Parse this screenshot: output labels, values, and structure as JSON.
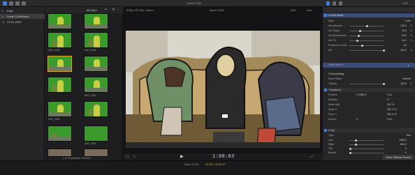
{
  "toolbar": {
    "tools_label": "Tools",
    "center_title": "Mark 3 Edit",
    "right_label": "4:56"
  },
  "sidebar": {
    "library": "Edyn",
    "items": [
      {
        "label": "Smart Collections",
        "selected": true
      },
      {
        "label": "21-01-2020",
        "selected": false
      }
    ]
  },
  "browser": {
    "filter": "All Clips",
    "thumbnails": [
      {
        "label": ""
      },
      {
        "label": ""
      },
      {
        "label": "IMG_0448"
      },
      {
        "label": "IMG_0449"
      },
      {
        "label": "IMG_0453"
      },
      {
        "label": ""
      },
      {
        "label": ""
      },
      {
        "label": "IMG_0450"
      },
      {
        "label": "IMG_0455"
      },
      {
        "label": ""
      },
      {
        "label": ""
      },
      {
        "label": "IMG_0461"
      },
      {
        "label": ""
      },
      {
        "label": ""
      }
    ],
    "status": "1 of 73 selected, 00:08:12"
  },
  "viewer": {
    "format": "1080p HD 30p, Stereo",
    "project": "Mark 3 Edit",
    "zoom": "80%",
    "view_label": "View",
    "timecode": "1:08:03"
  },
  "inspector": {
    "effect_name": "Comic Basic",
    "effect_params": [
      {
        "label": "Style",
        "value": "Color",
        "fraction": null
      },
      {
        "label": "Smoothness",
        "value": "100.0",
        "unit": "%",
        "fraction": 0.5
      },
      {
        "label": "Ink Edges",
        "value": "20.0",
        "unit": "%",
        "fraction": 0.3
      },
      {
        "label": "Ink Smoothness",
        "value": "15.0",
        "unit": "%",
        "fraction": 0.25
      },
      {
        "label": "Ink Fill",
        "value": "10.0",
        "unit": "%",
        "fraction": 0.2
      },
      {
        "label": "Posterize Levels",
        "value": "4.0",
        "unit": "",
        "fraction": 0.35
      },
      {
        "label": "Mix",
        "value": "100.0",
        "unit": "%",
        "fraction": 1.0
      }
    ],
    "color_board": "Color Board 1",
    "compositing": {
      "title": "Compositing",
      "blend_mode_label": "Blend Mode",
      "blend_mode": "Normal",
      "opacity_label": "Opacity",
      "opacity": "100.0",
      "opacity_fraction": 1.0
    },
    "transform": {
      "title": "Transform",
      "params": [
        {
          "label": "Position",
          "x": "X  1089.0",
          "y": "0  px"
        },
        {
          "label": "Rotation",
          "x": "",
          "y": "0  °"
        },
        {
          "label": "Scale (All)",
          "x": "",
          "y": "261  %"
        },
        {
          "label": "Scale X",
          "x": "",
          "y": "261.0  %"
        },
        {
          "label": "Scale Y",
          "x": "",
          "y": "261.0  %"
        },
        {
          "label": "Anchor",
          "x": "0",
          "y": "0  px"
        }
      ]
    },
    "crop": {
      "title": "Crop",
      "type_label": "Type",
      "type_value": "Trim",
      "params": [
        {
          "label": "Left",
          "value": "1080.0"
        },
        {
          "label": "Right",
          "value": "804.0"
        },
        {
          "label": "Top",
          "value": "0"
        },
        {
          "label": "Bottom",
          "value": "0"
        }
      ]
    },
    "save_button": "Save Effects Preset"
  },
  "statusbar": {
    "center": "Mark 3 Edit",
    "duration": "06:38 / 00:00:07"
  },
  "colors": {
    "accent": "#3d7fe0",
    "green_screen": "#3a9a2c",
    "selection": "#e0a520"
  }
}
